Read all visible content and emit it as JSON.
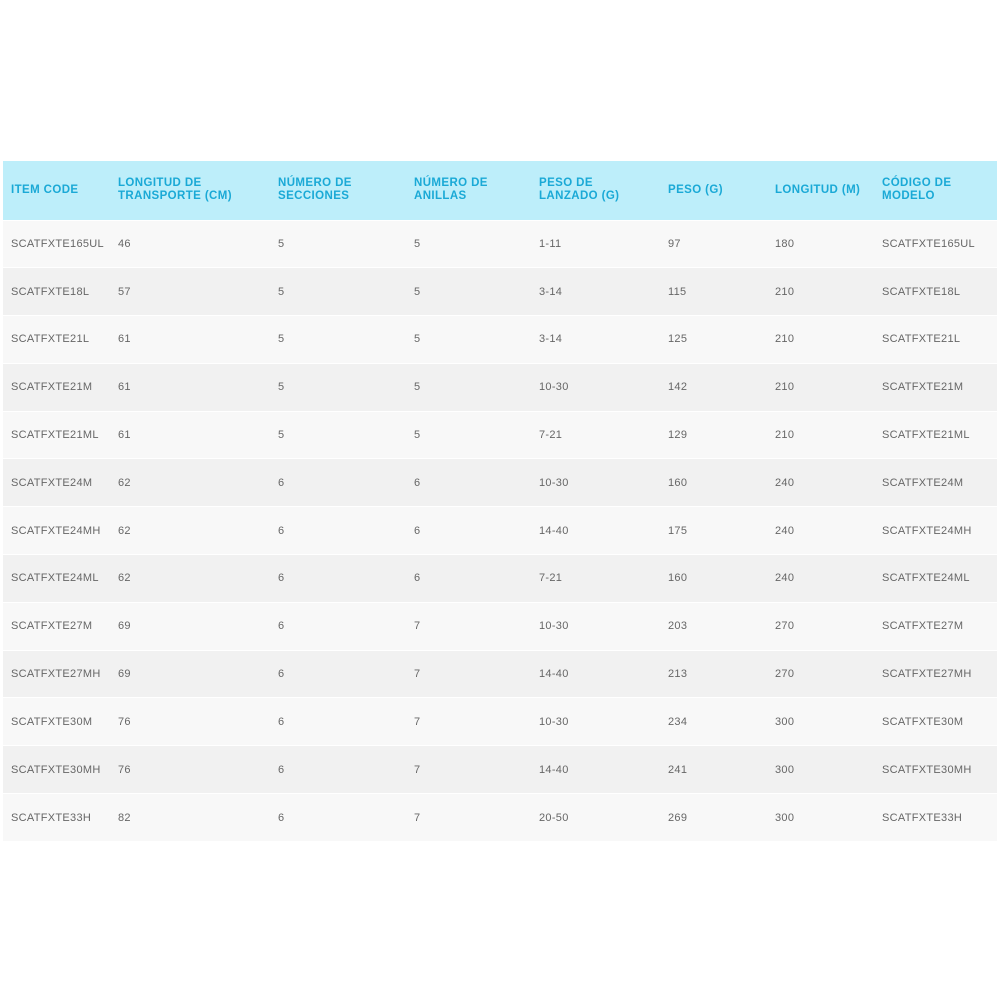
{
  "table": {
    "headers": [
      "ITEM CODE",
      "LONGITUD DE TRANSPORTE (CM)",
      "NÚMERO DE SECCIONES",
      "NÚMERO DE ANILLAS",
      "PESO DE LANZADO (G)",
      "PESO (G)",
      "LONGITUD (M)",
      "CÓDIGO DE MODELO"
    ],
    "rows": [
      [
        "SCATFXTE165UL",
        "46",
        "5",
        "5",
        "1-11",
        "97",
        "180",
        "SCATFXTE165UL"
      ],
      [
        "SCATFXTE18L",
        "57",
        "5",
        "5",
        "3-14",
        "115",
        "210",
        "SCATFXTE18L"
      ],
      [
        "SCATFXTE21L",
        "61",
        "5",
        "5",
        "3-14",
        "125",
        "210",
        "SCATFXTE21L"
      ],
      [
        "SCATFXTE21M",
        "61",
        "5",
        "5",
        "10-30",
        "142",
        "210",
        "SCATFXTE21M"
      ],
      [
        "SCATFXTE21ML",
        "61",
        "5",
        "5",
        "7-21",
        "129",
        "210",
        "SCATFXTE21ML"
      ],
      [
        "SCATFXTE24M",
        "62",
        "6",
        "6",
        "10-30",
        "160",
        "240",
        "SCATFXTE24M"
      ],
      [
        "SCATFXTE24MH",
        "62",
        "6",
        "6",
        "14-40",
        "175",
        "240",
        "SCATFXTE24MH"
      ],
      [
        "SCATFXTE24ML",
        "62",
        "6",
        "6",
        "7-21",
        "160",
        "240",
        "SCATFXTE24ML"
      ],
      [
        "SCATFXTE27M",
        "69",
        "6",
        "7",
        "10-30",
        "203",
        "270",
        "SCATFXTE27M"
      ],
      [
        "SCATFXTE27MH",
        "69",
        "6",
        "7",
        "14-40",
        "213",
        "270",
        "SCATFXTE27MH"
      ],
      [
        "SCATFXTE30M",
        "76",
        "6",
        "7",
        "10-30",
        "234",
        "300",
        "SCATFXTE30M"
      ],
      [
        "SCATFXTE30MH",
        "76",
        "6",
        "7",
        "14-40",
        "241",
        "300",
        "SCATFXTE30MH"
      ],
      [
        "SCATFXTE33H",
        "82",
        "6",
        "7",
        "20-50",
        "269",
        "300",
        "SCATFXTE33H"
      ]
    ]
  },
  "colors": {
    "header_bg": "#bdeefa",
    "header_text": "#1aa9d6",
    "row_odd": "#f8f8f8",
    "row_even": "#f1f1f1",
    "cell_text": "#666666"
  }
}
